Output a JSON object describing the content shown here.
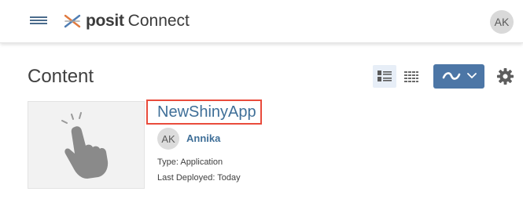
{
  "header": {
    "brand": "posit",
    "product": "Connect",
    "user_initials": "AK"
  },
  "icons": {
    "menu": "hamburger-menu-icon",
    "logo": "posit-logo-mark",
    "list_view": "list-view-icon",
    "grid_view": "grid-view-icon",
    "publish": "publish-icon",
    "dropdown": "chevron-down-icon",
    "settings": "gear-icon",
    "thumbnail": "pointing-hand-icon"
  },
  "colors": {
    "accent": "#4c76a6",
    "link": "#3f6f98",
    "highlight_box": "#e94b3c"
  },
  "page": {
    "title": "Content"
  },
  "content_item": {
    "title": "NewShinyApp",
    "owner_initials": "AK",
    "owner_name": "Annika",
    "type_text": "Type: Application",
    "deployed_text": "Last Deployed: Today"
  }
}
